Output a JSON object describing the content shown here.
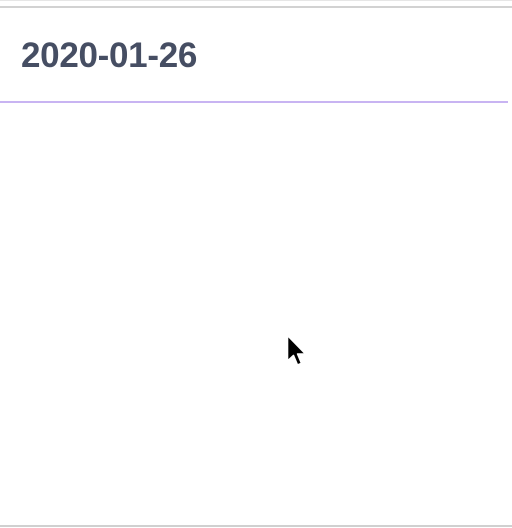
{
  "header": {
    "date": "2020-01-26"
  },
  "colors": {
    "title": "#464e63",
    "accent_underline": "#c8b4f2",
    "background": "#ffffff"
  },
  "icons": {
    "cursor": "mouse-pointer-arrow-icon"
  }
}
